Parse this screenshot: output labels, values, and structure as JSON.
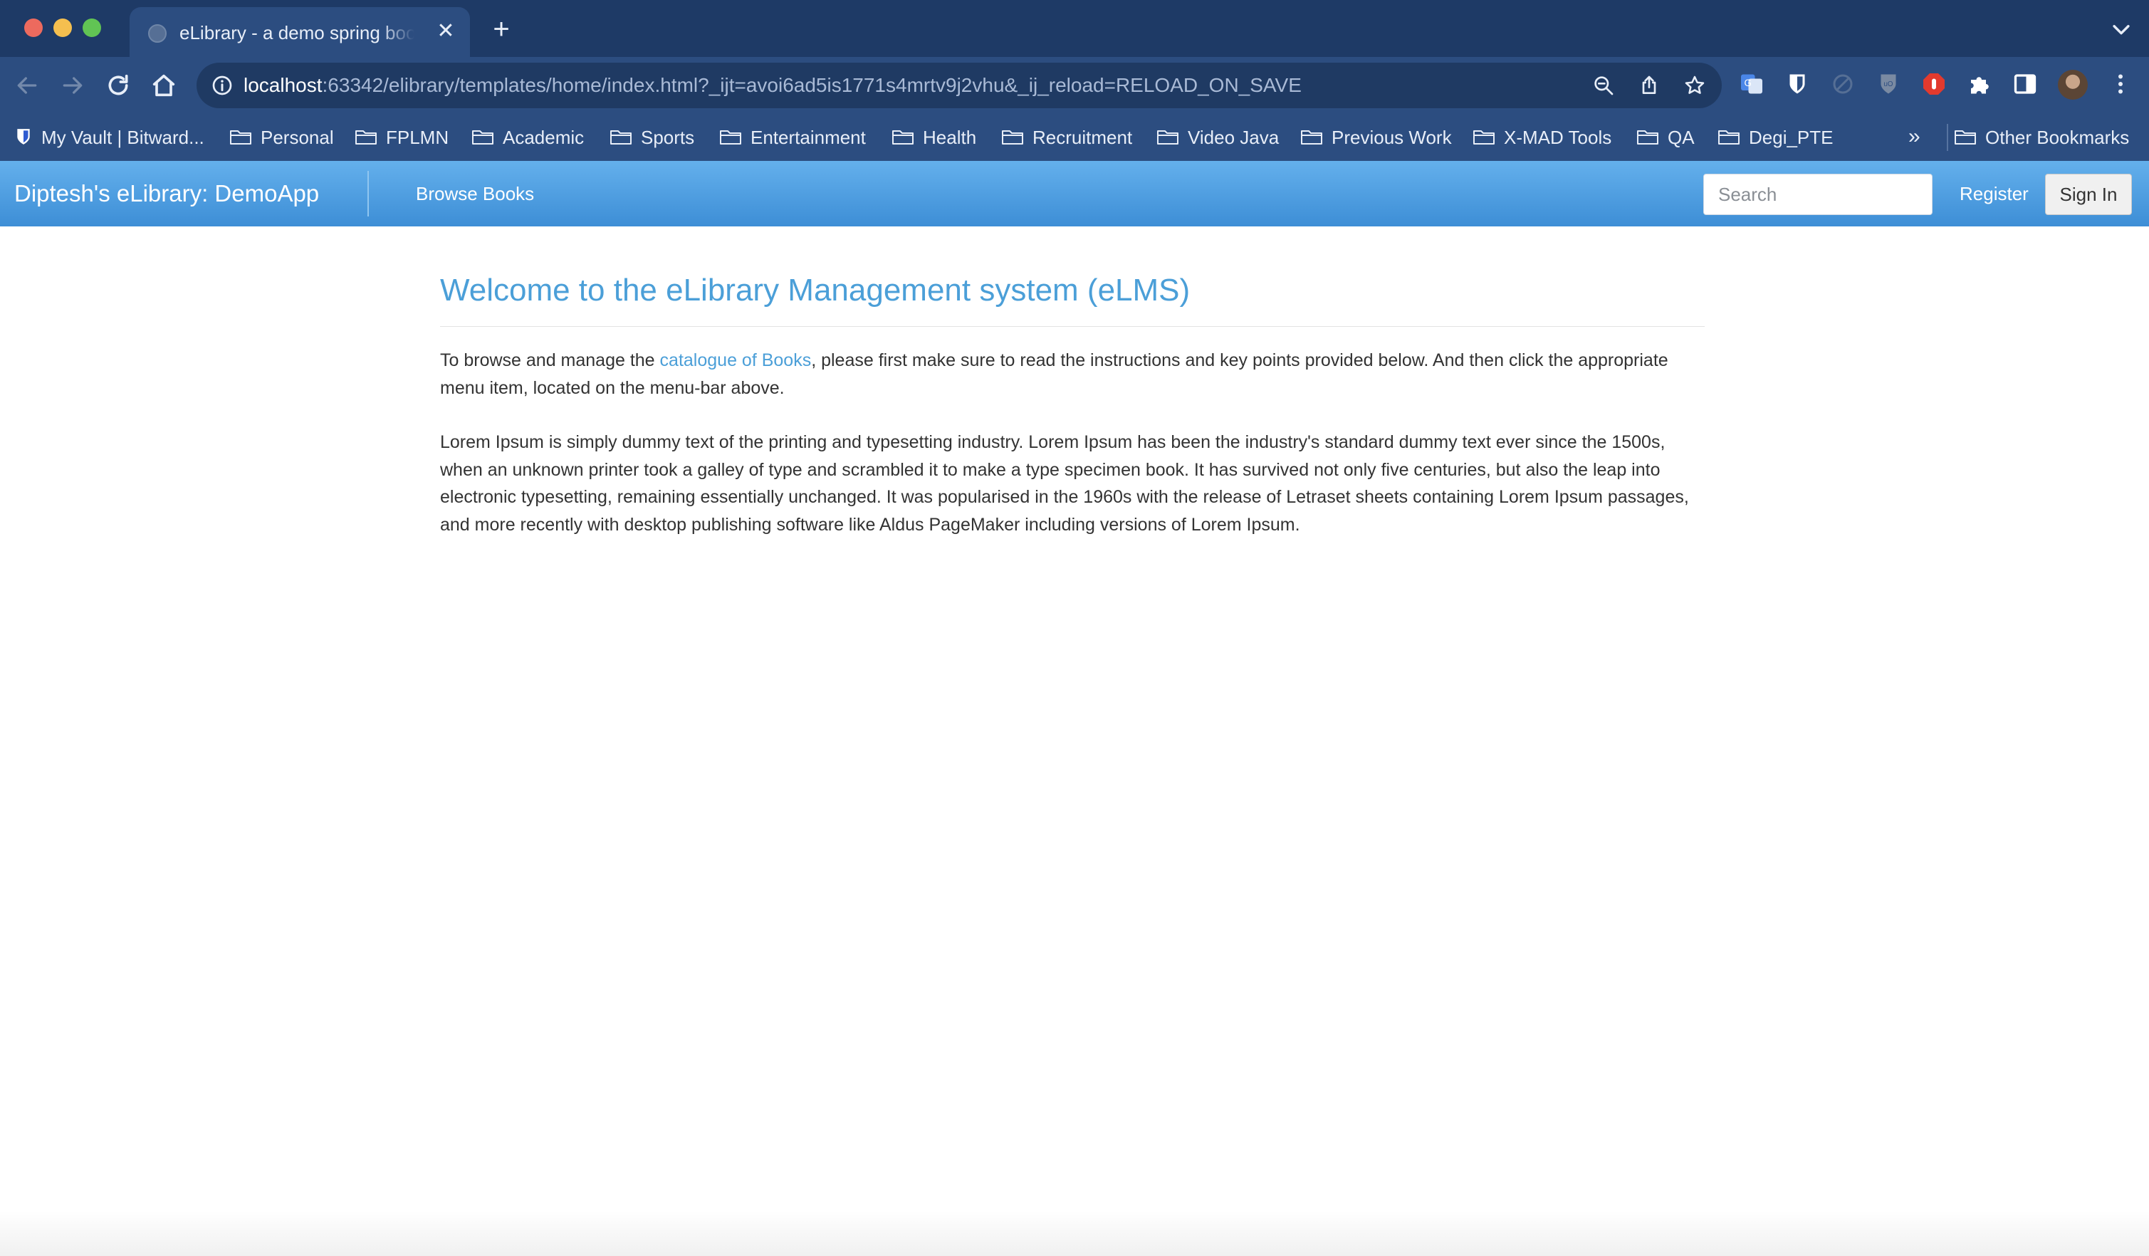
{
  "browser": {
    "tab": {
      "title": "eLibrary - a demo spring boot web app"
    },
    "url": {
      "host": "localhost",
      "path": ":63342/elibrary/templates/home/index.html?_ijt=avoi6ad5is1771s4mrtv9j2vhu&_ij_reload=RELOAD_ON_SAVE"
    },
    "bookmarks": [
      "My Vault | Bitward...",
      "Personal",
      "FPLMN",
      "Academic",
      "Sports",
      "Entertainment",
      "Health",
      "Recruitment",
      "Video Java",
      "Previous Work",
      "X-MAD Tools",
      "QA",
      "Degi_PTE"
    ],
    "overflow": "»",
    "other_bookmarks": "Other Bookmarks"
  },
  "navbar": {
    "brand": "Diptesh's eLibrary: DemoApp",
    "browse": "Browse Books",
    "search_placeholder": "Search",
    "register": "Register",
    "signin": "Sign In"
  },
  "content": {
    "heading": "Welcome to the eLibrary Management system (eLMS)",
    "intro_before": "To browse and manage the ",
    "intro_link": "catalogue of Books",
    "intro_after": ", please first make sure to read the instructions and key points provided below. And then click the appropriate menu item, located on the menu-bar above.",
    "lorem": "Lorem Ipsum is simply dummy text of the printing and typesetting industry. Lorem Ipsum has been the industry's standard dummy text ever since the 1500s, when an unknown printer took a galley of type and scrambled it to make a type specimen book. It has survived not only five centuries, but also the leap into electronic typesetting, remaining essentially unchanged. It was popularised in the 1960s with the release of Letraset sheets containing Lorem Ipsum passages, and more recently with desktop publishing software like Aldus PageMaker including versions of Lorem Ipsum."
  }
}
